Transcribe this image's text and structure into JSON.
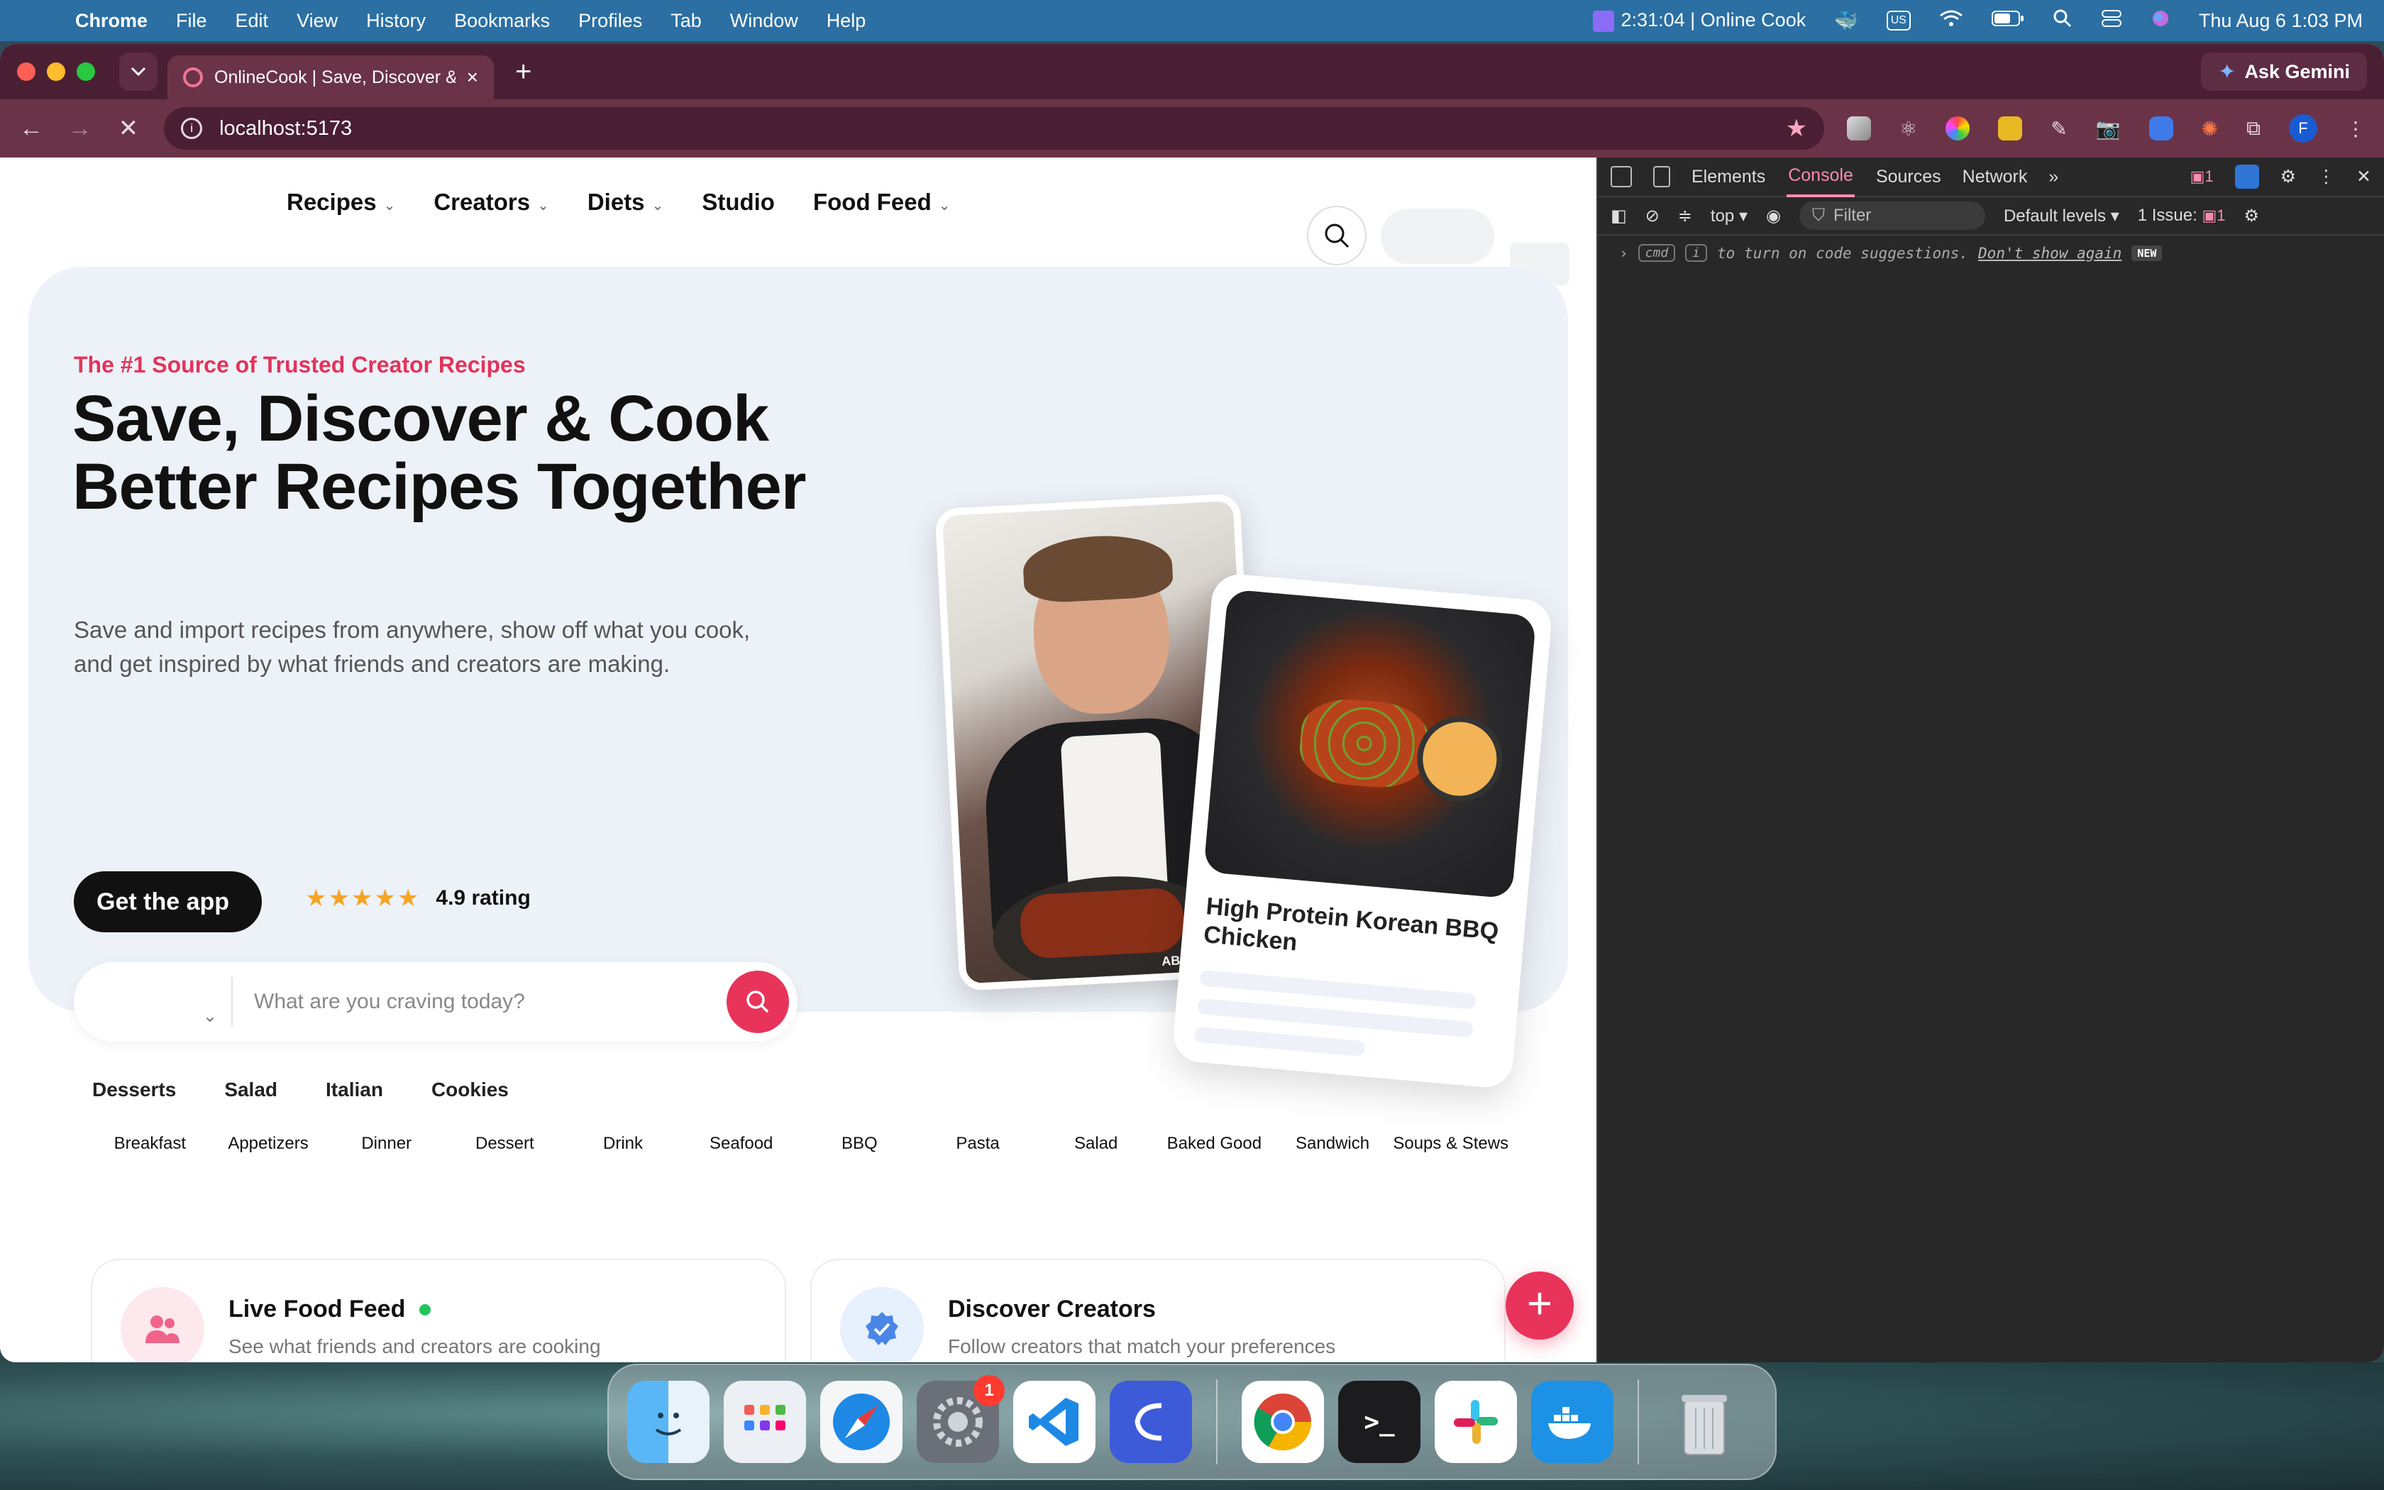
{
  "menubar": {
    "app_name": "Chrome",
    "menus": [
      "File",
      "Edit",
      "View",
      "History",
      "Bookmarks",
      "Profiles",
      "Tab",
      "Window",
      "Help"
    ],
    "timer": "2:31:04 | Online Cook",
    "input_source": "US",
    "datetime": "Thu Aug 6  1:03 PM"
  },
  "browser": {
    "tab_title": "OnlineCook | Save, Discover & Cook",
    "url": "localhost:5173",
    "ask_gemini": "Ask Gemini",
    "profile_initial": "F"
  },
  "site": {
    "nav": [
      {
        "label": "Recipes",
        "has_menu": true
      },
      {
        "label": "Creators",
        "has_menu": true
      },
      {
        "label": "Diets",
        "has_menu": true
      },
      {
        "label": "Studio",
        "has_menu": false
      },
      {
        "label": "Food Feed",
        "has_menu": true
      }
    ],
    "hero": {
      "eyebrow": "The #1 Source of Trusted Creator Recipes",
      "title": "Save, Discover & Cook Better Recipes Together",
      "subtitle": "Save and import recipes from anywhere, show off what you cook, and get inspired by what friends and creators are making.",
      "cta": "Get the app",
      "rating_text": "4.9 rating",
      "stars": 5,
      "search_placeholder": "What are you craving today?",
      "chips": [
        "Desserts",
        "Salad",
        "Italian",
        "Cookies"
      ],
      "recipe_card_title": "High Protein Korean BBQ Chicken",
      "photo_overlay": "ABOUT"
    },
    "categories": [
      "Breakfast",
      "Appetizers",
      "Dinner",
      "Dessert",
      "Drink",
      "Seafood",
      "BBQ",
      "Pasta",
      "Salad",
      "Baked Good",
      "Sandwich",
      "Soups & Stews"
    ],
    "feed_card": {
      "title": "Live Food Feed",
      "subtitle": "See what friends and creators are cooking"
    },
    "creators_card": {
      "title": "Discover Creators",
      "subtitle": "Follow creators that match your preferences"
    },
    "fab": "+"
  },
  "devtools": {
    "tabs": [
      "Elements",
      "Console",
      "Sources",
      "Network"
    ],
    "active_tab": "Console",
    "message_count": "1",
    "context": "top",
    "filter_placeholder": "Filter",
    "levels": "Default levels",
    "issues": "1 Issue:",
    "issue_count": "1",
    "console_hint": {
      "key1": "cmd",
      "key2": "i",
      "text": "to turn on code suggestions.",
      "link": "Don't show again",
      "tag": "NEW"
    }
  },
  "dock": {
    "settings_badge": "1",
    "terminal_prompt": ">_"
  },
  "colors": {
    "brand": "#e8345a",
    "hero_bg": "#edf2f8",
    "tab_bar": "#4a1f33",
    "devtools_accent": "#f68bb0"
  }
}
